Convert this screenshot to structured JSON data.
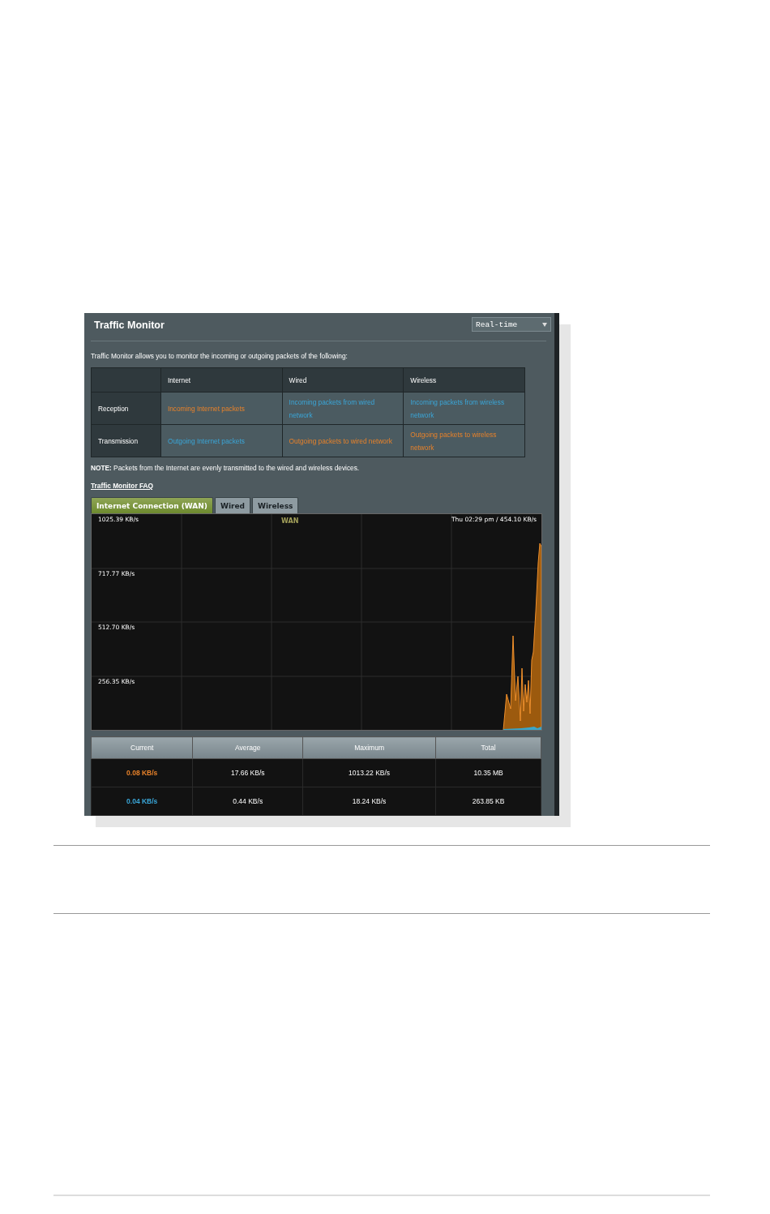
{
  "panel": {
    "title": "Traffic Monitor",
    "period_select": {
      "value": "Real-time"
    }
  },
  "description": "Traffic Monitor allows you to monitor the incoming or outgoing packets of the following:",
  "packet_table": {
    "columns": [
      "Internet",
      "Wired",
      "Wireless"
    ],
    "rows": [
      {
        "label": "Reception",
        "cells": [
          {
            "text": "Incoming Internet packets",
            "kind": "download"
          },
          {
            "text": "Incoming packets from wired network",
            "kind": "upload"
          },
          {
            "text": "Incoming packets from wireless network",
            "kind": "upload"
          }
        ]
      },
      {
        "label": "Transmission",
        "cells": [
          {
            "text": "Outgoing Internet packets",
            "kind": "upload"
          },
          {
            "text": "Outgoing packets to wired network",
            "kind": "download"
          },
          {
            "text": "Outgoing packets to wireless network",
            "kind": "download"
          }
        ]
      }
    ]
  },
  "note": "**NOTE:** Packets from the Internet are evenly transmitted to the wired and wireless devices.",
  "faq_link": "Traffic Monitor FAQ",
  "tabs": [
    {
      "label": "Internet Connection (WAN)",
      "selected": true
    },
    {
      "label": "Wired",
      "selected": false
    },
    {
      "label": "Wireless",
      "selected": false
    }
  ],
  "chart": {
    "title": "WAN",
    "status": "Thu 02:29 pm / 454.10 KB/s",
    "y_labels": [
      "1025.39 KB/s",
      "717.77 KB/s",
      "512.70 KB/s",
      "256.35 KB/s"
    ]
  },
  "stats": {
    "columns": [
      "Current",
      "Average",
      "Maximum",
      "Total"
    ],
    "rows": [
      {
        "kind": "download",
        "cells": [
          "0.08 KB/s",
          "17.66 KB/s",
          "1013.22 KB/s",
          "10.35 MB"
        ]
      },
      {
        "kind": "upload",
        "cells": [
          "0.04 KB/s",
          "0.44 KB/s",
          "18.24 KB/s",
          "263.85 KB"
        ]
      }
    ]
  }
}
